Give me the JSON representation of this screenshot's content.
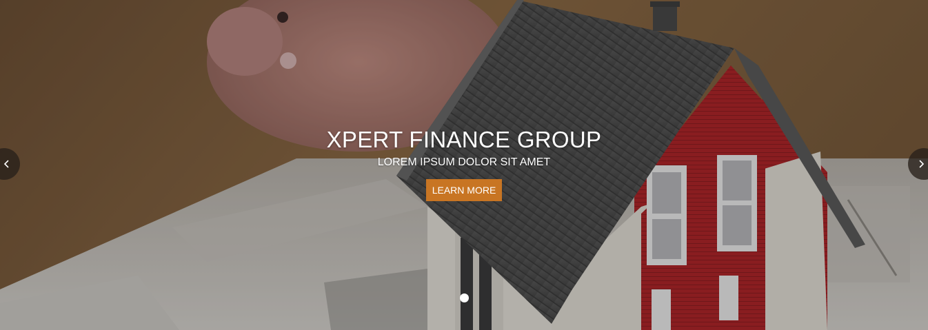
{
  "slider": {
    "title": "XPERT FINANCE GROUP",
    "subtitle": "LOREM IPSUM DOLOR SIT AMET",
    "button_label": "LEARN MORE",
    "prev_icon": "chevron-left-icon",
    "next_icon": "chevron-right-icon",
    "active_slide": 1,
    "slide_count": 1
  },
  "colors": {
    "button": "#c87523",
    "arrow_bg": "#2a2019",
    "text": "#ffffff"
  }
}
